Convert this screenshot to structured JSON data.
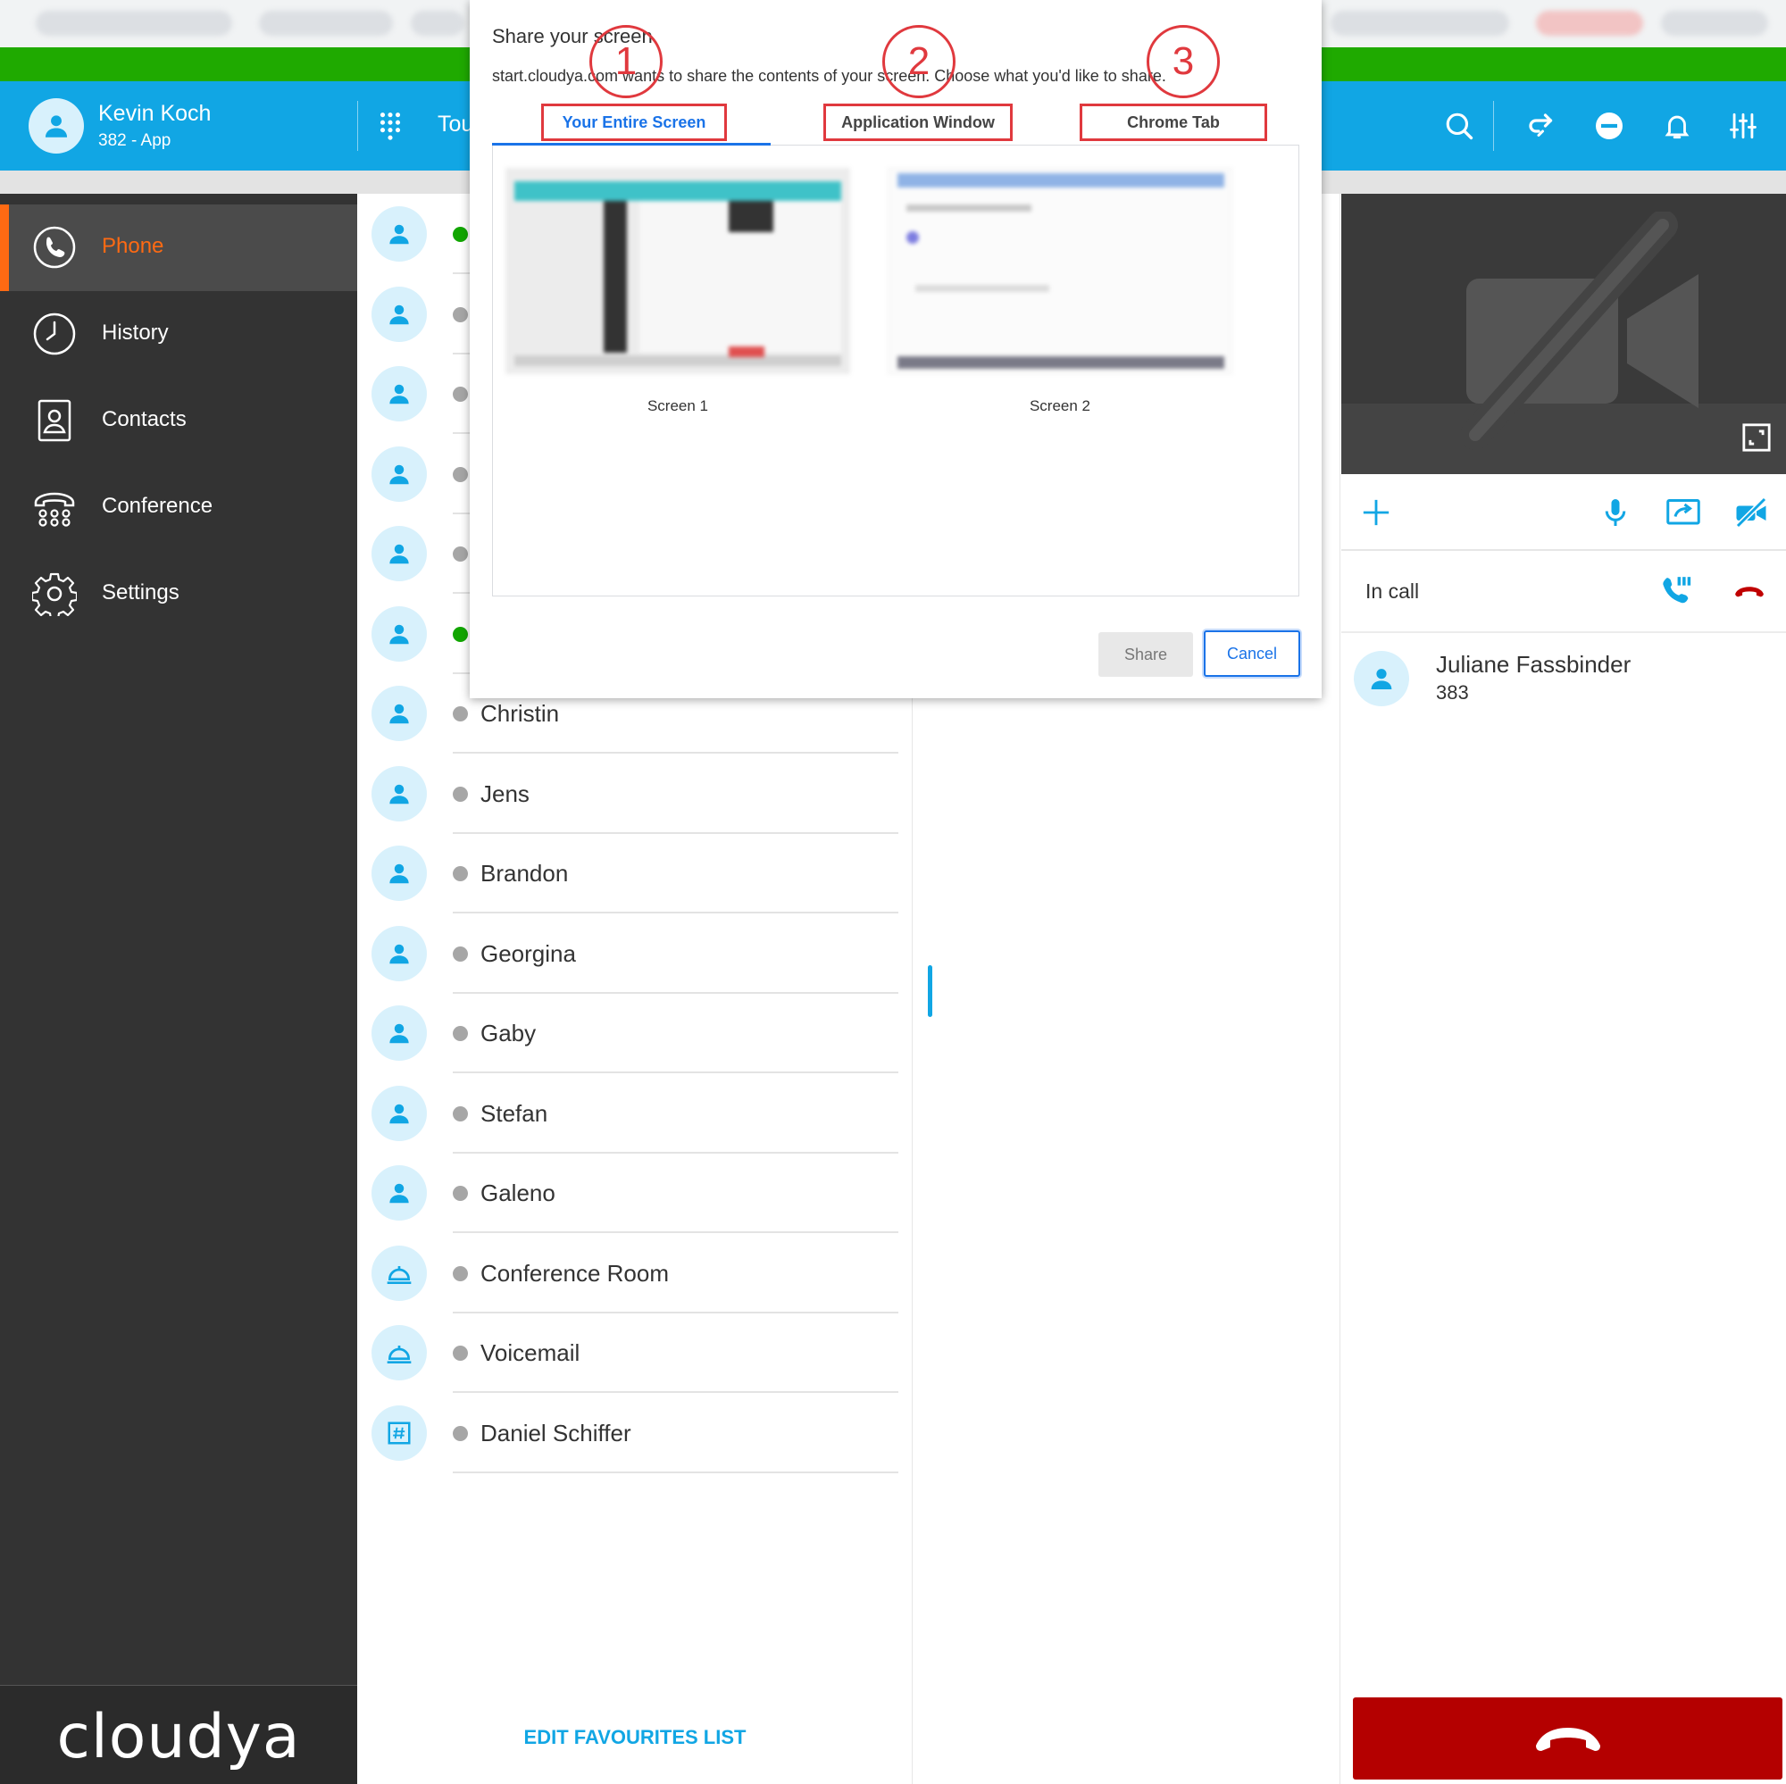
{
  "header": {
    "user_name": "Kevin Koch",
    "user_ext": "382 - App",
    "partial_title": "Tou"
  },
  "sidebar": {
    "items": [
      {
        "label": "Phone",
        "icon": "phone-icon",
        "active": true
      },
      {
        "label": "History",
        "icon": "clock-icon",
        "active": false
      },
      {
        "label": "Contacts",
        "icon": "contact-card-icon",
        "active": false
      },
      {
        "label": "Conference",
        "icon": "conference-phone-icon",
        "active": false
      },
      {
        "label": "Settings",
        "icon": "gear-icon",
        "active": false
      }
    ],
    "brand": "cloudya"
  },
  "favourites": {
    "rows": [
      {
        "name": "",
        "status": "online",
        "icon": "person-icon"
      },
      {
        "name": "",
        "status": "offline",
        "icon": "person-icon"
      },
      {
        "name": "",
        "status": "offline",
        "icon": "person-icon"
      },
      {
        "name": "",
        "status": "offline",
        "icon": "person-icon"
      },
      {
        "name": "",
        "status": "offline",
        "icon": "person-icon"
      },
      {
        "name": "",
        "status": "online",
        "icon": "person-icon"
      },
      {
        "name": "Christin",
        "status": "offline",
        "icon": "person-icon"
      },
      {
        "name": "Jens",
        "status": "offline",
        "icon": "person-icon"
      },
      {
        "name": "Brandon",
        "status": "offline",
        "icon": "person-icon"
      },
      {
        "name": "Georgina",
        "status": "offline",
        "icon": "person-icon"
      },
      {
        "name": "Gaby",
        "status": "offline",
        "icon": "person-icon"
      },
      {
        "name": "Stefan",
        "status": "offline",
        "icon": "person-icon"
      },
      {
        "name": "Galeno",
        "status": "offline",
        "icon": "person-icon"
      },
      {
        "name": "Conference Room",
        "status": "offline",
        "icon": "bell-service-icon"
      },
      {
        "name": "Voicemail",
        "status": "offline",
        "icon": "bell-service-icon"
      },
      {
        "name": "Daniel Schiffer",
        "status": "offline",
        "icon": "hash-icon"
      }
    ],
    "edit_label": "EDIT FAVOURITES LIST"
  },
  "call": {
    "status": "In call",
    "callee_name": "Juliane Fassbinder",
    "callee_ext": "383"
  },
  "dialog": {
    "title": "Share your screen",
    "description": "start.cloudya.com wants to share the contents of your screen. Choose what you'd like to share.",
    "tabs": [
      {
        "label": "Your Entire Screen",
        "active": true
      },
      {
        "label": "Application Window",
        "active": false
      },
      {
        "label": "Chrome Tab",
        "active": false
      }
    ],
    "screens": [
      "Screen 1",
      "Screen 2"
    ],
    "share_label": "Share",
    "cancel_label": "Cancel",
    "annotations": [
      "1",
      "2",
      "3"
    ]
  },
  "colors": {
    "header_blue": "#11a6e4",
    "accent_orange": "#ff6a13",
    "hangup_red": "#b40000",
    "online_green": "#11a600",
    "annotation_red": "#e0393e"
  }
}
